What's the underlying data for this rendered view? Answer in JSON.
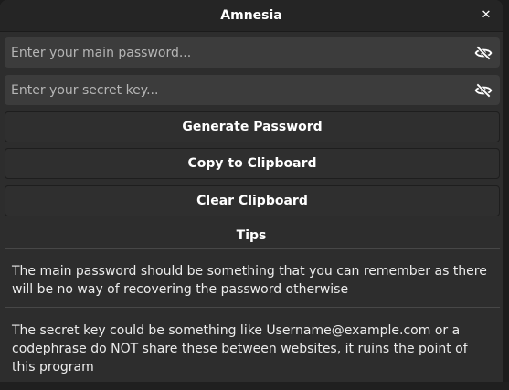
{
  "window": {
    "title": "Amnesia",
    "close_icon": "close-icon"
  },
  "fields": {
    "main_password": {
      "placeholder": "Enter your main password...",
      "value": "",
      "icon": "eye-slash-icon"
    },
    "secret_key": {
      "placeholder": "Enter your secret key...",
      "value": "",
      "icon": "eye-slash-icon"
    }
  },
  "buttons": {
    "generate": "Generate Password",
    "copy": "Copy to Clipboard",
    "clear": "Clear Clipboard"
  },
  "tips": {
    "title": "Tips",
    "items": [
      "The main password should be something that you can remember as there will be no way of recovering the password otherwise",
      "The secret key could be something like Username@example.com or a codephrase do NOT share these between websites, it ruins the point of this program"
    ]
  },
  "colors": {
    "window_bg": "#2d2d2d",
    "titlebar_bg": "#252525",
    "field_bg": "#3c3c3c",
    "text": "#ffffff"
  }
}
